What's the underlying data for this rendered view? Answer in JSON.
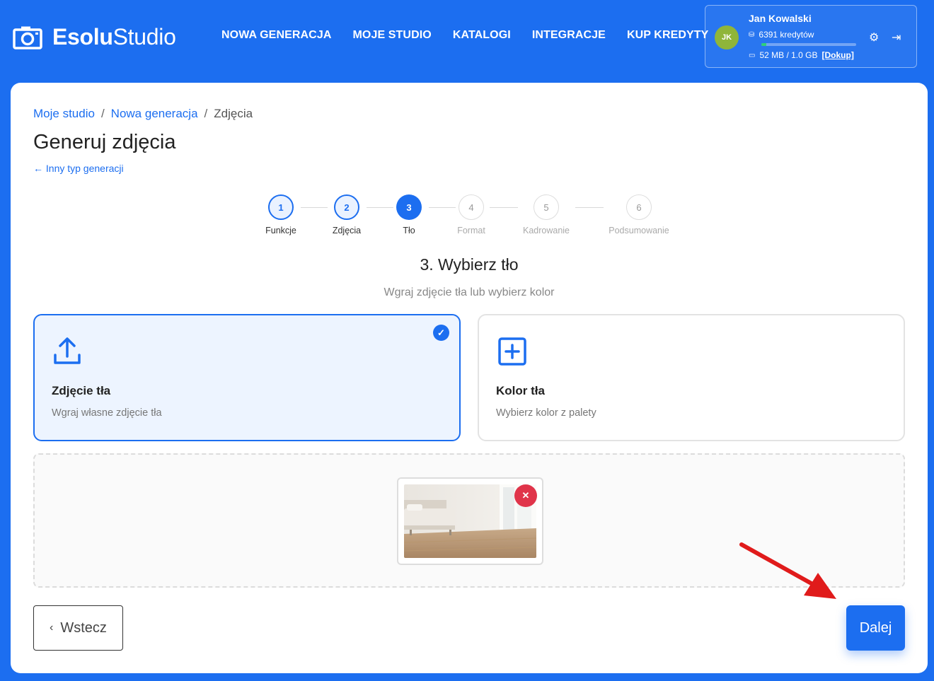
{
  "brand": {
    "name_bold": "Esolu",
    "name_light": "Studio"
  },
  "nav": [
    "NOWA GENERACJA",
    "MOJE STUDIO",
    "KATALOGI",
    "INTEGRACJE",
    "KUP KREDYTY"
  ],
  "user": {
    "initials": "JK",
    "name": "Jan Kowalski",
    "credits": "6391 kredytów",
    "storage": "52 MB / 1.0 GB",
    "storage_used_fraction": 0.05,
    "topup": "[Dokup]"
  },
  "breadcrumb": {
    "item1": "Moje studio",
    "item2": "Nowa generacja",
    "item3": "Zdjęcia",
    "sep": "/"
  },
  "page": {
    "title": "Generuj zdjęcia",
    "back_link": "← Inny typ generacji"
  },
  "steps": [
    {
      "num": "1",
      "label": "Funkcje",
      "state": "done"
    },
    {
      "num": "2",
      "label": "Zdjęcia",
      "state": "done"
    },
    {
      "num": "3",
      "label": "Tło",
      "state": "active"
    },
    {
      "num": "4",
      "label": "Format",
      "state": "todo"
    },
    {
      "num": "5",
      "label": "Kadrowanie",
      "state": "todo"
    },
    {
      "num": "6",
      "label": "Podsumowanie",
      "state": "todo"
    }
  ],
  "section": {
    "title": "3. Wybierz tło",
    "subtitle": "Wgraj zdjęcie tła lub wybierz kolor"
  },
  "options": {
    "photo": {
      "title": "Zdjęcie tła",
      "desc": "Wgraj własne zdjęcie tła"
    },
    "color": {
      "title": "Kolor tła",
      "desc": "Wybierz kolor z palety"
    }
  },
  "buttons": {
    "back": "Wstecz",
    "next": "Dalej"
  },
  "colors": {
    "accent": "#1c6ef0",
    "remove": "#e0344a",
    "avatar": "#8fb53a",
    "arrow": "#e01b1b"
  }
}
